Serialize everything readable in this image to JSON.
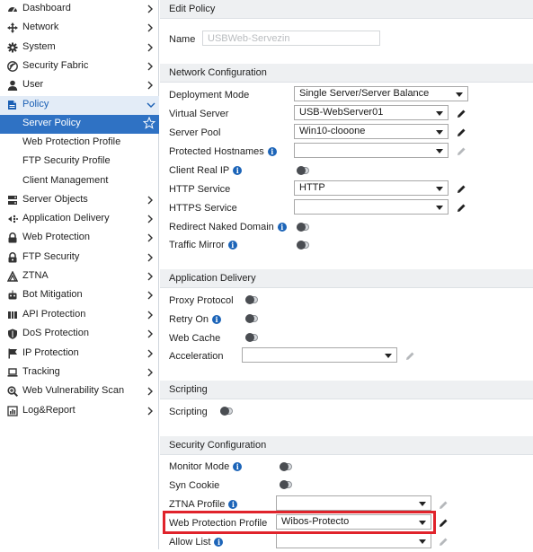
{
  "sidebar": {
    "items": [
      {
        "label": "Dashboard",
        "icon": "dashboard-icon"
      },
      {
        "label": "Network",
        "icon": "network-icon"
      },
      {
        "label": "System",
        "icon": "gear-icon"
      },
      {
        "label": "Security Fabric",
        "icon": "security-fabric-icon"
      },
      {
        "label": "User",
        "icon": "user-icon"
      },
      {
        "label": "Policy",
        "icon": "policy-icon"
      },
      {
        "label": "Server Objects",
        "icon": "server-objects-icon"
      },
      {
        "label": "Application Delivery",
        "icon": "app-delivery-icon"
      },
      {
        "label": "Web Protection",
        "icon": "lock-icon"
      },
      {
        "label": "FTP Security",
        "icon": "ftp-lock-icon"
      },
      {
        "label": "ZTNA",
        "icon": "ztna-icon"
      },
      {
        "label": "Bot Mitigation",
        "icon": "bot-icon"
      },
      {
        "label": "API Protection",
        "icon": "api-icon"
      },
      {
        "label": "DoS Protection",
        "icon": "shield-icon"
      },
      {
        "label": "IP Protection",
        "icon": "ip-flag-icon"
      },
      {
        "label": "Tracking",
        "icon": "laptop-icon"
      },
      {
        "label": "Web Vulnerability Scan",
        "icon": "scan-icon"
      },
      {
        "label": "Log&Report",
        "icon": "log-report-icon"
      }
    ],
    "policy_sub": [
      {
        "label": "Server Policy"
      },
      {
        "label": "Web Protection Profile"
      },
      {
        "label": "FTP Security Profile"
      },
      {
        "label": "Client Management"
      }
    ]
  },
  "main": {
    "edit_title": "Edit Policy",
    "name_label": "Name",
    "name_value": "USBWeb-Servezin",
    "sections": {
      "network": "Network Configuration",
      "app_delivery": "Application Delivery",
      "scripting": "Scripting",
      "security": "Security Configuration"
    },
    "network": {
      "deployment_mode": {
        "label": "Deployment Mode",
        "value": "Single Server/Server Balance"
      },
      "virtual_server": {
        "label": "Virtual Server",
        "value": "USB-WebServer01"
      },
      "server_pool": {
        "label": "Server Pool",
        "value": "Win10-clooone"
      },
      "protected_hostnames": {
        "label": "Protected Hostnames",
        "value": ""
      },
      "client_real_ip": {
        "label": "Client Real IP"
      },
      "http_service": {
        "label": "HTTP Service",
        "value": "HTTP"
      },
      "https_service": {
        "label": "HTTPS Service",
        "value": ""
      },
      "redirect_naked": {
        "label": "Redirect Naked Domain"
      },
      "traffic_mirror": {
        "label": "Traffic Mirror"
      }
    },
    "app_delivery": {
      "proxy_protocol": {
        "label": "Proxy Protocol"
      },
      "retry_on": {
        "label": "Retry On"
      },
      "web_cache": {
        "label": "Web Cache"
      },
      "acceleration": {
        "label": "Acceleration",
        "value": ""
      }
    },
    "scripting": {
      "label": "Scripting"
    },
    "security": {
      "monitor_mode": {
        "label": "Monitor Mode"
      },
      "syn_cookie": {
        "label": "Syn Cookie"
      },
      "ztna_profile": {
        "label": "ZTNA Profile",
        "value": ""
      },
      "web_protection_profile": {
        "label": "Web Protection Profile",
        "value": "Wibos-Protecto"
      },
      "allow_list": {
        "label": "Allow List",
        "value": ""
      }
    }
  },
  "colors": {
    "accent": "#2f72c4",
    "highlight_border": "#e0232b",
    "info_icon": "#1c64b8"
  }
}
